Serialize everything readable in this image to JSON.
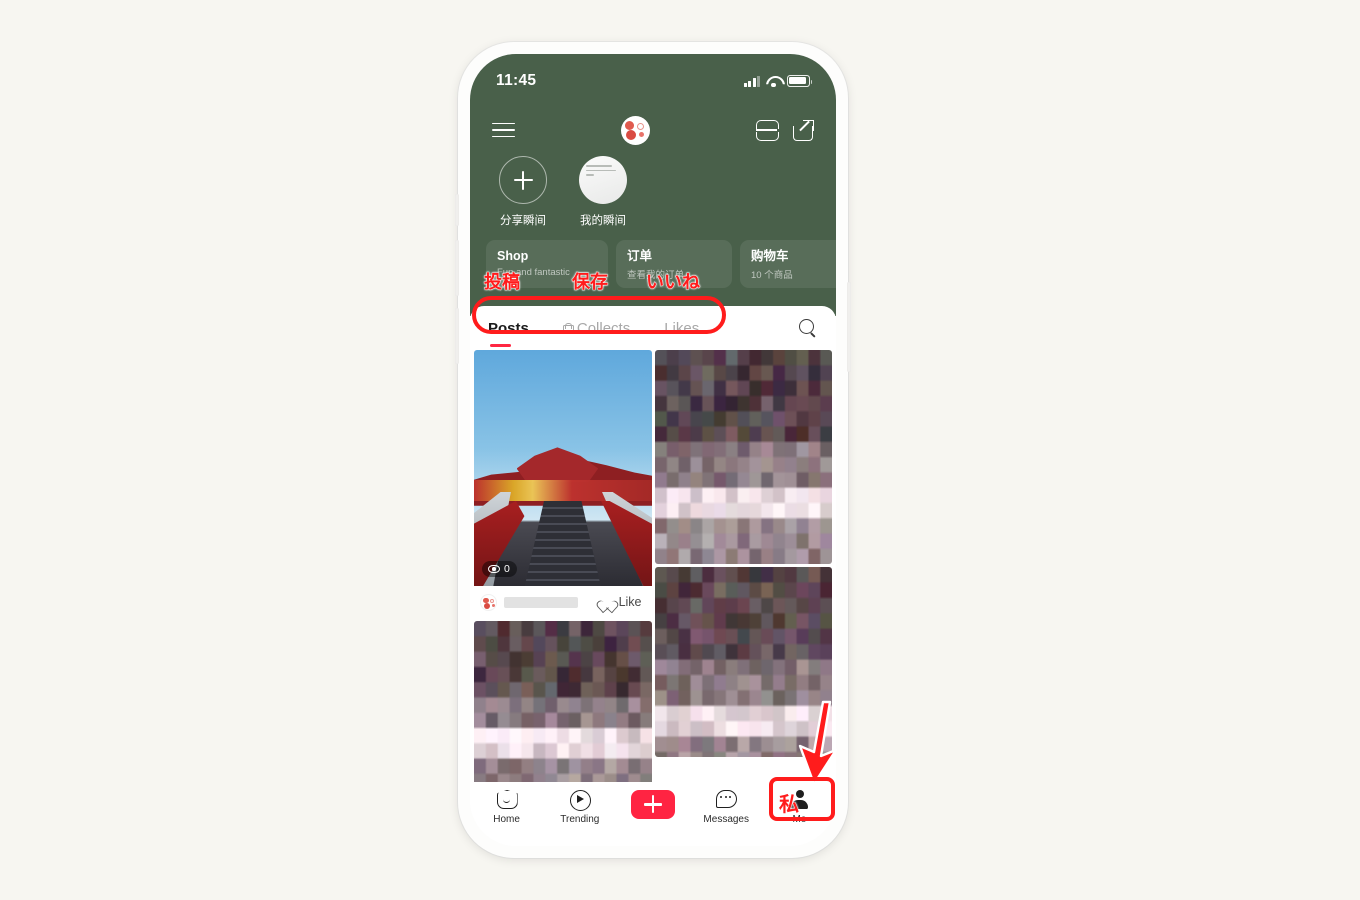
{
  "page": {
    "background_color": "#f7f6f1",
    "device": "smartphone-mockup"
  },
  "status_bar": {
    "time": "11:45",
    "signal_icon": "cellular-signal-icon",
    "wifi_icon": "wifi-icon",
    "battery_icon": "battery-icon"
  },
  "header": {
    "background_color": "#49604a",
    "menu_icon": "hamburger-menu-icon",
    "avatar_icon": "profile-avatar",
    "scan_icon": "qr-scan-icon",
    "share_icon": "share-external-icon"
  },
  "moments": [
    {
      "label": "分享瞬间",
      "icon": "plus-icon",
      "type": "add"
    },
    {
      "label": "我的瞬间",
      "icon": "note-thumbnail",
      "type": "note"
    }
  ],
  "shop_cards": [
    {
      "title": "Shop",
      "subtitle": "Fun and fantastic"
    },
    {
      "title": "订单",
      "subtitle": "查看我的订单"
    },
    {
      "title": "购物车",
      "subtitle": "10 个商品"
    },
    {
      "title": "",
      "subtitle": ""
    }
  ],
  "content_tabs": {
    "items": [
      {
        "label": "Posts",
        "active": true,
        "icon": null
      },
      {
        "label": "Collects",
        "active": false,
        "icon": "lock-icon"
      },
      {
        "label": "Likes",
        "active": false,
        "icon": null
      }
    ],
    "active_underline_color": "#ff2742",
    "search_icon": "search-icon"
  },
  "feed": {
    "posts": [
      {
        "id": "post-escalator",
        "type": "photo",
        "description": "escalator-toward-red-temple",
        "view_count": "0",
        "view_icon": "eye-icon",
        "like_label": "Like",
        "like_icon": "heart-outline-icon",
        "author_name_redacted": true
      },
      {
        "id": "post-mosaic-1",
        "type": "mosaic",
        "description": "censored-thumbnail"
      },
      {
        "id": "post-mosaic-2",
        "type": "mosaic",
        "description": "censored-thumbnail"
      },
      {
        "id": "post-mosaic-3",
        "type": "mosaic",
        "description": "censored-thumbnail"
      }
    ]
  },
  "bottom_nav": {
    "items": [
      {
        "label": "Home",
        "icon": "home-icon",
        "active": false
      },
      {
        "label": "Trending",
        "icon": "play-circle-icon",
        "active": false
      },
      {
        "label": "",
        "icon": "plus-button-icon",
        "active": false,
        "is_create": true
      },
      {
        "label": "Messages",
        "icon": "chat-bubble-icon",
        "active": false
      },
      {
        "label": "Me",
        "icon": "person-icon",
        "active": true
      }
    ],
    "create_button_color": "#ff2442"
  },
  "annotations": {
    "color": "#ff1c1c",
    "labels": [
      {
        "text": "投稿",
        "meaning": "maps-to-Posts-tab"
      },
      {
        "text": "保存",
        "meaning": "maps-to-Collects-tab"
      },
      {
        "text": "いいね",
        "meaning": "maps-to-Likes-tab"
      },
      {
        "text": "私",
        "meaning": "maps-to-Me-tab"
      }
    ],
    "highlight_boxes": [
      "content-tabs-row",
      "me-nav-item"
    ],
    "arrow": "down-arrow-pointing-to-me-tab"
  }
}
